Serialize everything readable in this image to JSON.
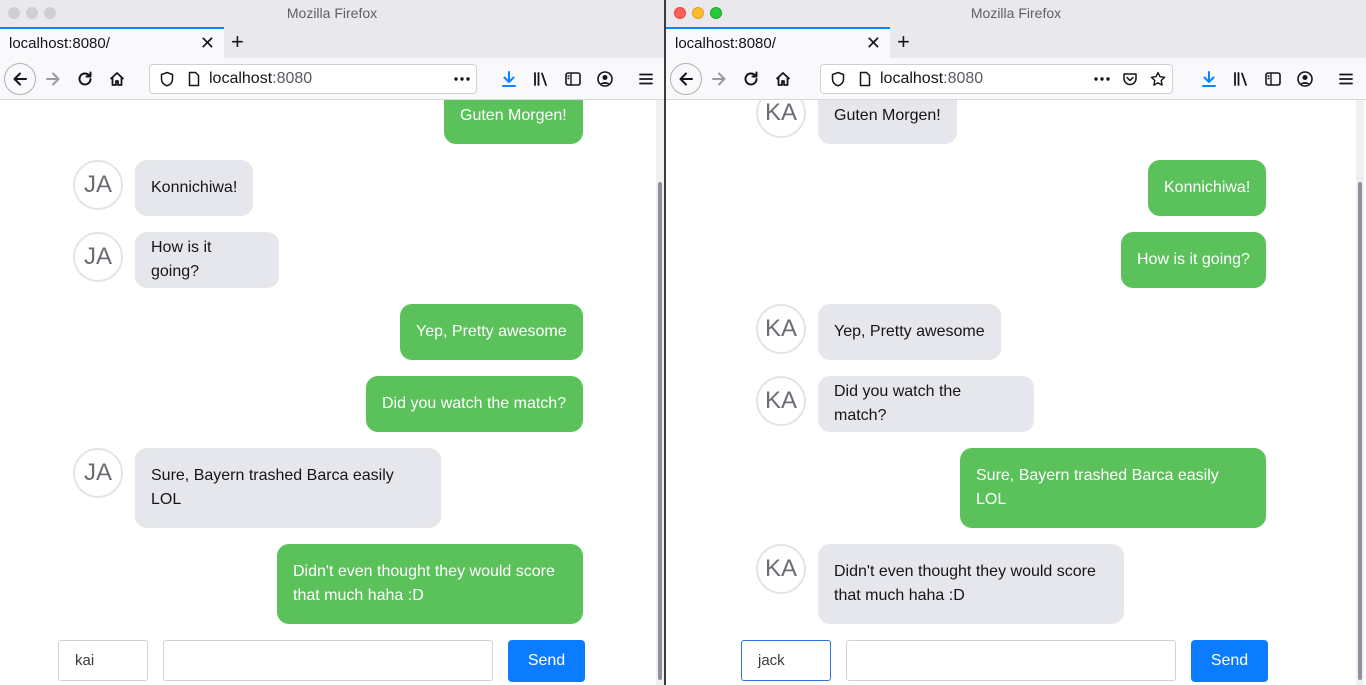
{
  "left": {
    "window_title": "Mozilla Firefox",
    "tab_title": "localhost:8080/",
    "url_host": "localhost",
    "url_port": ":8080",
    "avatar_initials": "JA",
    "name_field_value": "kai",
    "send_label": "Send",
    "messages": [
      {
        "text": "Guten Morgen!",
        "side": "me"
      },
      {
        "text": "Konnichiwa!",
        "side": "them"
      },
      {
        "text": "How is it going?",
        "side": "them"
      },
      {
        "text": "Yep, Pretty awesome",
        "side": "me"
      },
      {
        "text": "Did you watch the match?",
        "side": "me"
      },
      {
        "text": "Sure, Bayern trashed Barca easily LOL",
        "side": "them"
      },
      {
        "text": "Didn't even thought they would score that much haha :D",
        "side": "me"
      }
    ]
  },
  "right": {
    "window_title": "Mozilla Firefox",
    "tab_title": "localhost:8080/",
    "url_host": "localhost",
    "url_port": ":8080",
    "avatar_initials": "KA",
    "name_field_value": "jack",
    "send_label": "Send",
    "messages": [
      {
        "text": "Guten Morgen!",
        "side": "them"
      },
      {
        "text": "Konnichiwa!",
        "side": "me"
      },
      {
        "text": "How is it going?",
        "side": "me"
      },
      {
        "text": "Yep, Pretty awesome",
        "side": "them"
      },
      {
        "text": "Did you watch the match?",
        "side": "them"
      },
      {
        "text": "Sure, Bayern trashed Barca easily LOL",
        "side": "me"
      },
      {
        "text": "Didn't even thought they would score that much haha :D",
        "side": "them"
      }
    ]
  },
  "colors": {
    "own_bubble": "#5bc15b",
    "other_bubble": "#e6e7ec",
    "send_button": "#0b7bff",
    "active_tab_accent": "#0a84ff"
  },
  "icons": [
    "back-arrow-icon",
    "forward-arrow-icon",
    "reload-icon",
    "home-icon",
    "shield-icon",
    "page-icon",
    "more-dots-icon",
    "pocket-icon",
    "star-icon",
    "download-icon",
    "library-icon",
    "sidebar-icon",
    "account-icon",
    "menu-icon"
  ]
}
